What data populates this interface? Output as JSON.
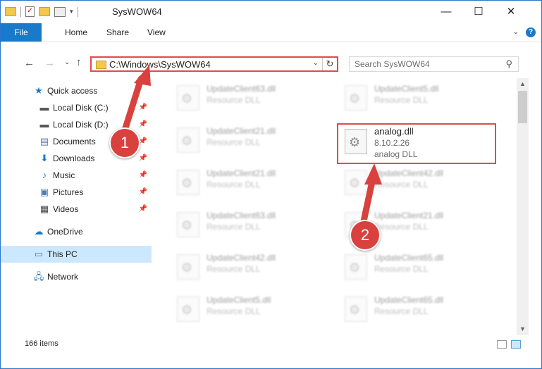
{
  "window": {
    "title": "SysWOW64",
    "minimize": "—",
    "maximize": "☐",
    "close": "✕"
  },
  "ribbon": {
    "tabs": [
      "File",
      "Home",
      "Share",
      "View"
    ]
  },
  "address": {
    "path": "C:\\Windows\\SysWOW64",
    "search_placeholder": "Search SysWOW64"
  },
  "nav": {
    "quick_access": "Quick access",
    "items": [
      {
        "label": "Local Disk (C:)",
        "icon": "drive-icon",
        "pinned": true
      },
      {
        "label": "Local Disk (D:)",
        "icon": "drive-icon",
        "pinned": true
      },
      {
        "label": "Documents",
        "icon": "documents-icon",
        "pinned": true
      },
      {
        "label": "Downloads",
        "icon": "download-arrow-icon",
        "pinned": true
      },
      {
        "label": "Music",
        "icon": "music-note-icon",
        "pinned": true
      },
      {
        "label": "Pictures",
        "icon": "pictures-icon",
        "pinned": true
      },
      {
        "label": "Videos",
        "icon": "film-icon",
        "pinned": true
      }
    ],
    "onedrive": "OneDrive",
    "this_pc": "This PC",
    "network": "Network"
  },
  "files": [
    {
      "name": "UpdateClient63.dll",
      "type": "Resource DLL"
    },
    {
      "name": "UpdateClient5.dll",
      "type": "Resource DLL"
    },
    {
      "name": "UpdateClient21.dll",
      "type": "Resource DLL"
    },
    {
      "name": "analog.dll",
      "version": "8.10.2.26",
      "type": "analog DLL",
      "selected": true
    },
    {
      "name": "UpdateClient21.dll",
      "type": "Resource DLL"
    },
    {
      "name": "UpdateClient42.dll",
      "type": "Resource DLL"
    },
    {
      "name": "UpdateClient63.dll",
      "type": "Resource DLL"
    },
    {
      "name": "UpdateClient21.dll",
      "type": "Resource DLL"
    },
    {
      "name": "UpdateClient42.dll",
      "type": "Resource DLL"
    },
    {
      "name": "UpdateClient65.dll",
      "type": "Resource DLL"
    },
    {
      "name": "UpdateClient5.dll",
      "type": "Resource DLL"
    },
    {
      "name": "UpdateClient65.dll",
      "type": "Resource DLL"
    }
  ],
  "status": {
    "item_count": "166 items"
  },
  "annotations": {
    "step1": "1",
    "step2": "2",
    "color": "#d8413e"
  }
}
